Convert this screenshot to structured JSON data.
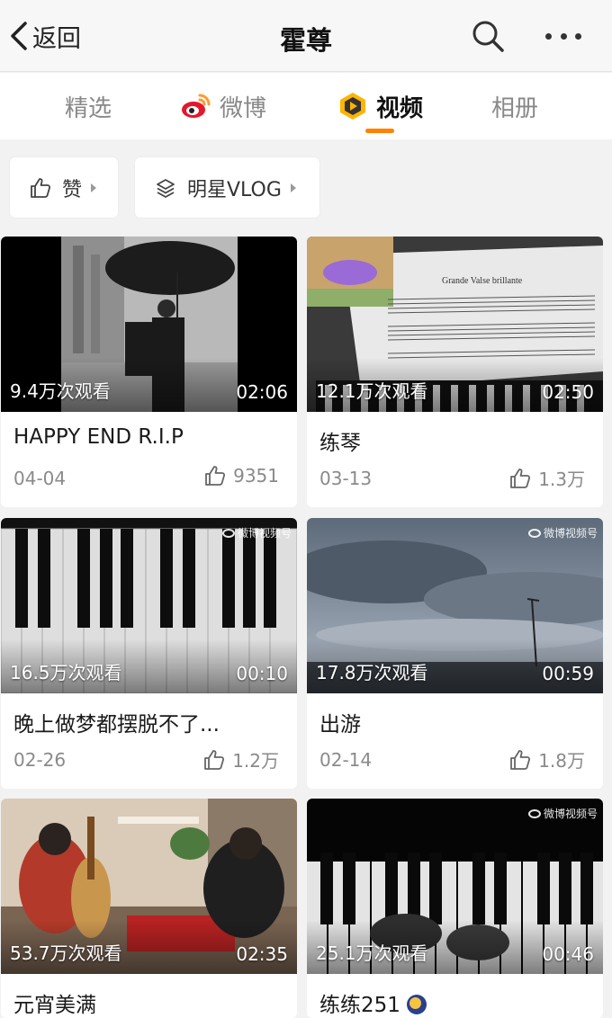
{
  "header": {
    "back_label": "返回",
    "title": "霍尊"
  },
  "tabs": [
    {
      "label": "精选",
      "active": false
    },
    {
      "label": "微博",
      "active": false,
      "icon": "weibo-icon"
    },
    {
      "label": "视频",
      "active": true,
      "icon": "video-icon"
    },
    {
      "label": "相册",
      "active": false
    }
  ],
  "filters": [
    {
      "label": "赞",
      "icon": "thumb-up-icon"
    },
    {
      "label": "明星VLOG",
      "icon": "layers-icon"
    }
  ],
  "videos": [
    {
      "title": "HAPPY END R.I.P",
      "views": "9.4万次观看",
      "duration": "02:06",
      "date": "04-04",
      "likes": "9351"
    },
    {
      "title": "练琴",
      "views": "12.1万次观看",
      "duration": "02:50",
      "date": "03-13",
      "likes": "1.3万",
      "thumb_text": "Grande Valse brillante"
    },
    {
      "title": "晚上做梦都摆脱不了...",
      "views": "16.5万次观看",
      "duration": "00:10",
      "date": "02-26",
      "likes": "1.2万",
      "watermark": "微博视频号"
    },
    {
      "title": "出游",
      "views": "17.8万次观看",
      "duration": "00:59",
      "date": "02-14",
      "likes": "1.8万",
      "watermark": "微博视频号"
    },
    {
      "title": "元宵美满",
      "views": "53.7万次观看",
      "duration": "02:35"
    },
    {
      "title": "练练251",
      "views": "25.1万次观看",
      "duration": "00:46",
      "watermark": "微博视频号"
    }
  ],
  "colors": {
    "accent": "#ff8200",
    "background": "#f2f2f2"
  }
}
